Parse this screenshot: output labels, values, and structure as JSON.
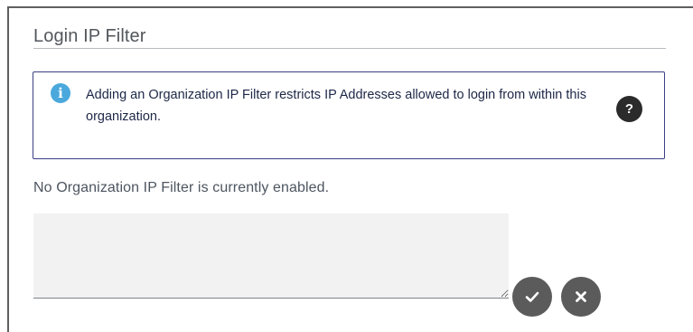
{
  "section": {
    "title": "Login IP Filter"
  },
  "info": {
    "icon": "info-icon",
    "icon_glyph": "i",
    "message": "Adding an Organization IP Filter restricts IP Addresses allowed to login from within this organization.",
    "help_icon": "question-icon",
    "help_glyph": "?"
  },
  "status": {
    "message": "No Organization IP Filter is currently enabled."
  },
  "ip_filter_input": {
    "value": "",
    "placeholder": ""
  },
  "actions": {
    "confirm_icon": "checkmark-icon",
    "cancel_icon": "close-icon"
  },
  "colors": {
    "info_border": "#3b3f85",
    "info_icon": "#4aa8dc",
    "help_button": "#2b2b2b",
    "action_button": "#5b5b5b",
    "input_background": "#f2f2f2"
  }
}
